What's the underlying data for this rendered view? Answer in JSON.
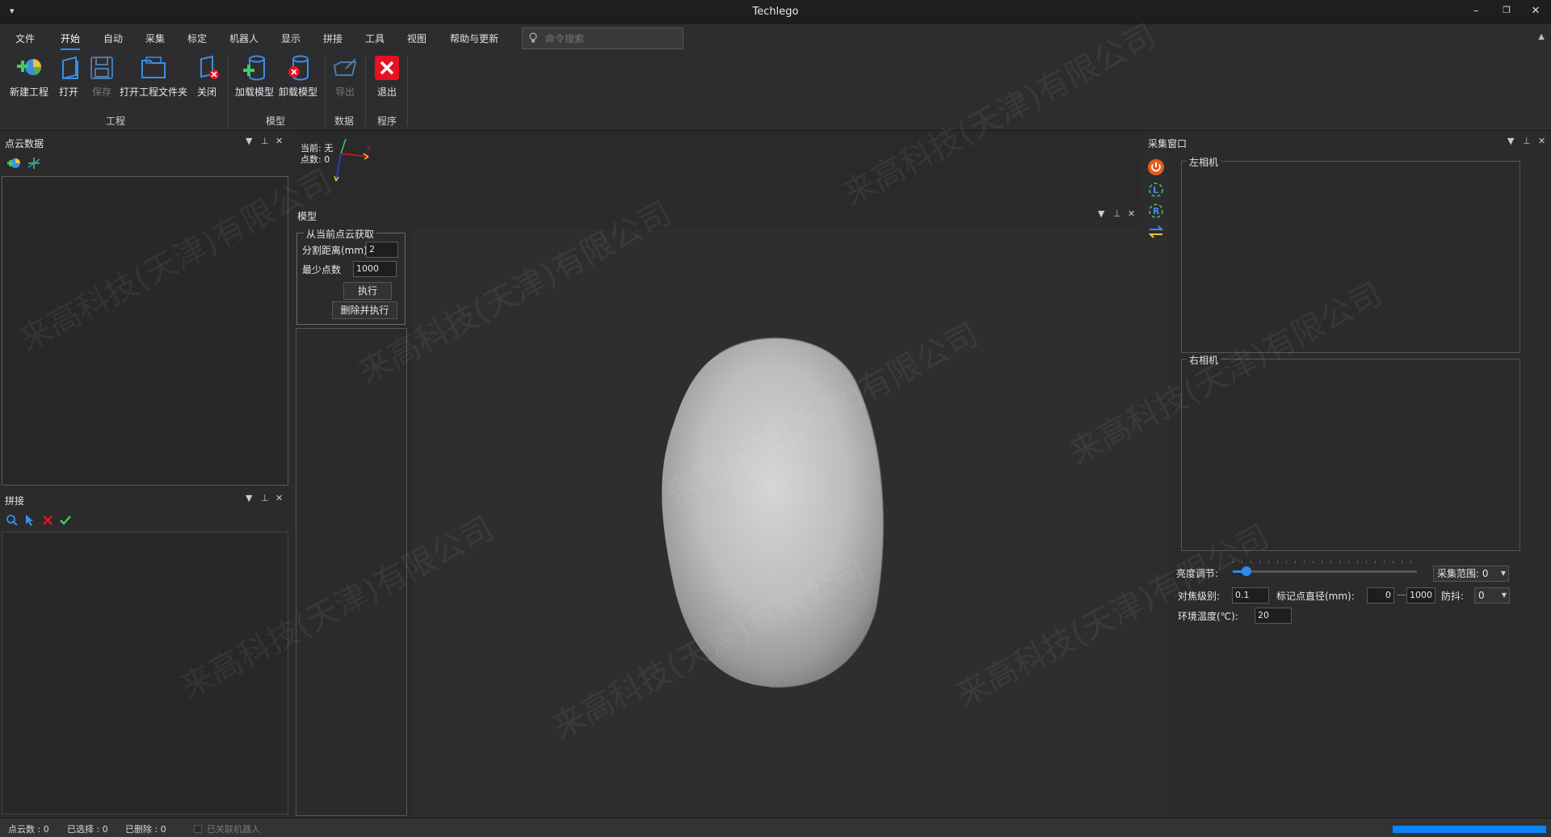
{
  "window": {
    "title": "Techlego",
    "sysmenu": "▾",
    "min": "–",
    "restore": "❐",
    "close": "✕"
  },
  "menu": [
    "文件",
    "开始",
    "自动",
    "采集",
    "标定",
    "机器人",
    "显示",
    "拼接",
    "工具",
    "视图",
    "帮助与更新"
  ],
  "search": {
    "placeholder": "命令搜索"
  },
  "ribbon": {
    "buttons": [
      "新建工程",
      "打开",
      "保存",
      "打开工程文件夹",
      "关闭",
      "加载模型",
      "卸载模型",
      "导出",
      "退出"
    ],
    "groups": [
      "工程",
      "模型",
      "数据",
      "程序"
    ]
  },
  "pointcloud_panel": {
    "title": "点云数据"
  },
  "stitch_panel": {
    "title": "拼接"
  },
  "overlay": {
    "current": "当前: 无",
    "points": "点数: 0"
  },
  "model_panel": {
    "title": "模型",
    "group_title": "从当前点云获取",
    "split_label": "分割距离(mm)",
    "split_value": "2",
    "min_points_label": "最少点数",
    "min_points_value": "1000",
    "execute": "执行",
    "delete_execute": "删除并执行"
  },
  "capture_panel": {
    "title": "采集窗口",
    "left_camera": "左相机",
    "right_camera": "右相机",
    "brightness_label": "亮度调节:",
    "brightness_level": 0.05,
    "capture_range": "采集范围: 0",
    "focus_label": "对焦级别:",
    "focus_value": "0.1",
    "marker_label": "标记点直径(mm):",
    "marker_min": "0",
    "marker_dash": "—",
    "marker_max": "1000",
    "shake_label": "防抖:",
    "shake_value": "0",
    "temp_label": "环境温度(℃):",
    "temp_value": "20"
  },
  "status": {
    "points": "点云数 : 0",
    "selected": "已选择 : 0",
    "deleted": "已删除 : 0",
    "robot": "已关联机器人"
  },
  "watermark": "来高科技(天津)有限公司",
  "colors": {
    "accent": "#2d8cf0",
    "progress": "#0a84ff",
    "exit": "#e81123"
  }
}
